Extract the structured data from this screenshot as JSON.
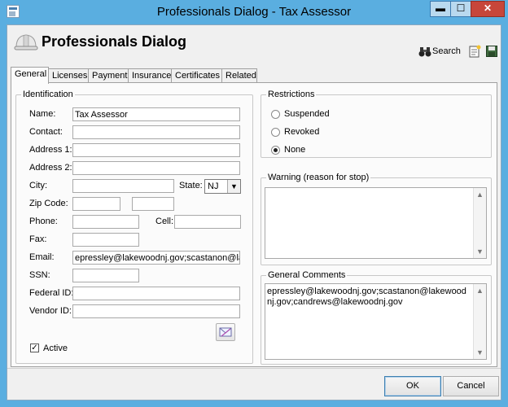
{
  "window": {
    "title": "Professionals Dialog - Tax Assessor",
    "minimize_glyph": "▬",
    "maximize_glyph": "☐",
    "close_glyph": "✕"
  },
  "header": {
    "title": "Professionals Dialog",
    "search_label": "Search",
    "icons": [
      "hardhat-icon",
      "binoculars-icon",
      "notes-icon",
      "save-icon"
    ]
  },
  "tabs": [
    {
      "label": "General",
      "active": true
    },
    {
      "label": "Licenses",
      "active": false
    },
    {
      "label": "Payment",
      "active": false
    },
    {
      "label": "Insurance",
      "active": false
    },
    {
      "label": "Certificates",
      "active": false
    },
    {
      "label": "Related",
      "active": false
    }
  ],
  "identification": {
    "title": "Identification",
    "name_label": "Name:",
    "name_value": "Tax Assessor",
    "contact_label": "Contact:",
    "contact_value": "",
    "address1_label": "Address 1:",
    "address1_value": "",
    "address2_label": "Address 2:",
    "address2_value": "",
    "city_label": "City:",
    "city_value": "",
    "state_label": "State:",
    "state_value": "NJ",
    "zip_label": "Zip Code:",
    "zip_value": "",
    "zip_ext_value": "",
    "phone_label": "Phone:",
    "phone_value": "",
    "cell_label": "Cell:",
    "cell_value": "",
    "fax_label": "Fax:",
    "fax_value": "",
    "email_label": "Email:",
    "email_value": "epressley@lakewoodnj.gov;scastanon@lakew",
    "ssn_label": "SSN:",
    "ssn_value": "",
    "federal_id_label": "Federal ID:",
    "federal_id_value": "",
    "vendor_id_label": "Vendor ID:",
    "vendor_id_value": "",
    "active_label": "Active",
    "active_checked": true,
    "check_glyph": "✓"
  },
  "restrictions": {
    "title": "Restrictions",
    "options": [
      {
        "label": "Suspended",
        "selected": false
      },
      {
        "label": "Revoked",
        "selected": false
      },
      {
        "label": "None",
        "selected": true
      }
    ]
  },
  "warning": {
    "title": "Warning (reason for stop)",
    "text": ""
  },
  "comments": {
    "title": "General Comments",
    "text": "epressley@lakewoodnj.gov;scastanon@lakewoodnj.gov;candrews@lakewoodnj.gov"
  },
  "footer": {
    "ok_label": "OK",
    "cancel_label": "Cancel"
  },
  "colors": {
    "titlebar": "#5aaee0",
    "close_button": "#c7463a",
    "dialog_bg": "#f0f0f0"
  }
}
